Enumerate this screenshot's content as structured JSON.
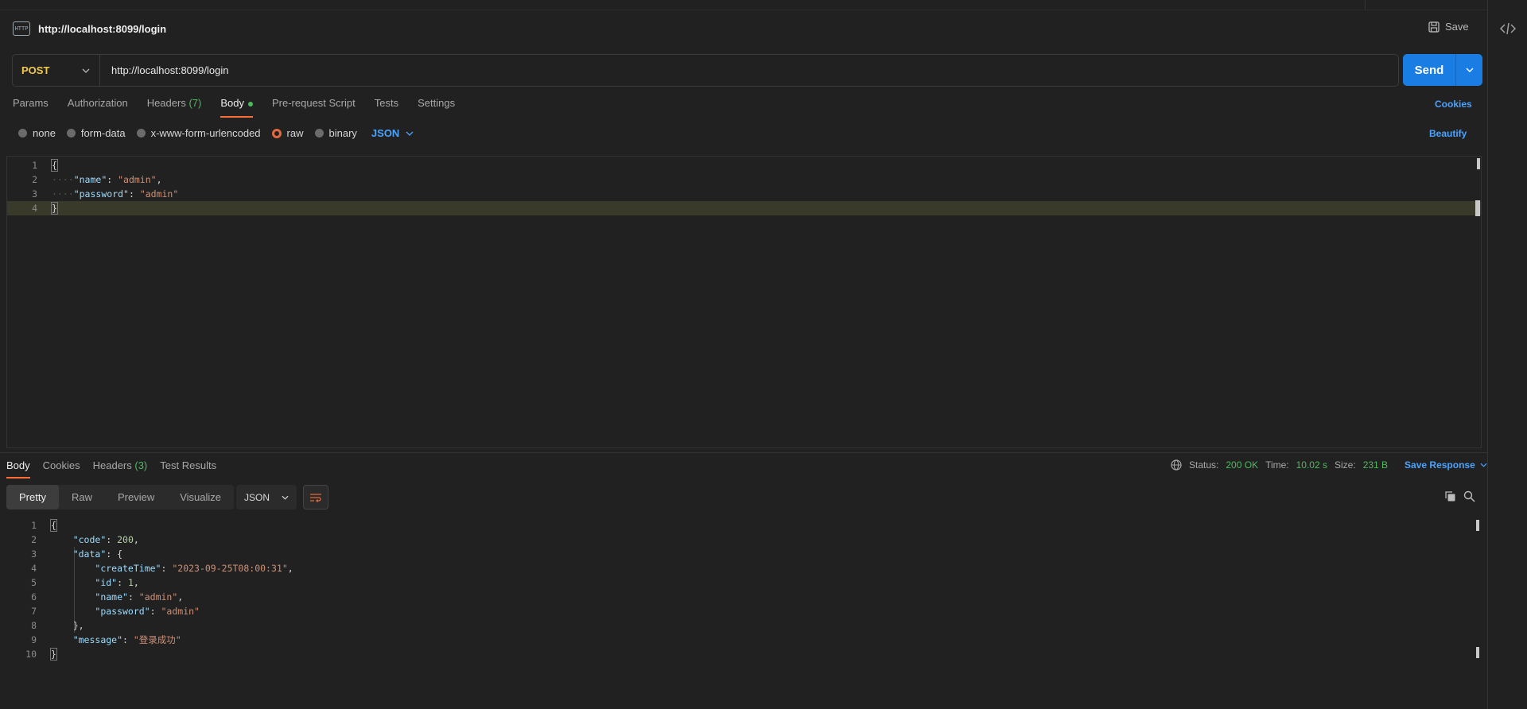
{
  "request": {
    "title": "http://localhost:8099/login",
    "save_label": "Save",
    "method": "POST",
    "url": "http://localhost:8099/login",
    "send_label": "Send",
    "tabs": [
      {
        "label": "Params"
      },
      {
        "label": "Authorization"
      },
      {
        "label": "Headers",
        "count": "(7)"
      },
      {
        "label": "Body"
      },
      {
        "label": "Pre-request Script"
      },
      {
        "label": "Tests"
      },
      {
        "label": "Settings"
      }
    ],
    "cookies_label": "Cookies",
    "body_types": [
      "none",
      "form-data",
      "x-www-form-urlencoded",
      "raw",
      "binary"
    ],
    "body_format": "JSON",
    "beautify_label": "Beautify",
    "body_lines": [
      {
        "n": "1",
        "text": "{"
      },
      {
        "n": "2",
        "key": "\"name\"",
        "sep": ": ",
        "value": "\"admin\"",
        "tail": ","
      },
      {
        "n": "3",
        "key": "\"password\"",
        "sep": ": ",
        "value": "\"admin\""
      },
      {
        "n": "4",
        "text": "}"
      }
    ]
  },
  "response": {
    "tabs": [
      {
        "label": "Body"
      },
      {
        "label": "Cookies"
      },
      {
        "label": "Headers",
        "count": "(3)"
      },
      {
        "label": "Test Results"
      }
    ],
    "status_label": "Status:",
    "status_value": "200 OK",
    "time_label": "Time:",
    "time_value": "10.02 s",
    "size_label": "Size:",
    "size_value": "231 B",
    "save_response_label": "Save Response",
    "view_modes": [
      "Pretty",
      "Raw",
      "Preview",
      "Visualize"
    ],
    "format": "JSON",
    "body_lines": [
      {
        "n": "1",
        "text": "{"
      },
      {
        "n": "2",
        "key": "\"code\"",
        "value_num": "200",
        "tail": ","
      },
      {
        "n": "3",
        "key": "\"data\"",
        "text_after": "{"
      },
      {
        "n": "4",
        "key": "\"createTime\"",
        "value": "\"2023-09-25T08:00:31\"",
        "tail": ","
      },
      {
        "n": "5",
        "key": "\"id\"",
        "value_num": "1",
        "tail": ","
      },
      {
        "n": "6",
        "key": "\"name\"",
        "value": "\"admin\"",
        "tail": ","
      },
      {
        "n": "7",
        "key": "\"password\"",
        "value": "\"admin\""
      },
      {
        "n": "8",
        "text": "},"
      },
      {
        "n": "9",
        "key": "\"message\"",
        "value": "\"登录成功\""
      },
      {
        "n": "10",
        "text": "}"
      }
    ]
  },
  "icons": {
    "request_type": "http-icon",
    "save": "save-icon",
    "method_dropdown": "chevron-down-icon",
    "send_dropdown": "chevron-down-icon",
    "code_panel": "code-icon",
    "globe": "globe-icon",
    "copy": "copy-icon",
    "search": "search-icon",
    "wrap": "wrap-lines-icon"
  },
  "colors": {
    "accent": "#1a7de4",
    "method": "#f2c94c",
    "status_ok": "#4cbb5e",
    "link": "#4aa3ff",
    "tab_underline": "#ff6c37"
  }
}
